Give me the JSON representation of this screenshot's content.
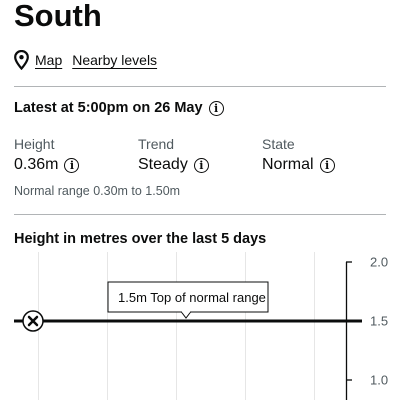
{
  "station": {
    "title": "South"
  },
  "links": {
    "map": "Map",
    "nearby": "Nearby levels"
  },
  "latest": {
    "heading": "Latest at 5:00pm on 26 May"
  },
  "stats": [
    {
      "label": "Height",
      "value": "0.36m"
    },
    {
      "label": "Trend",
      "value": "Steady"
    },
    {
      "label": "State",
      "value": "Normal"
    }
  ],
  "normal_range": "Normal range 0.30m to 1.50m",
  "chart_title": "Height in metres over the last 5 days",
  "tooltip": "1.5m Top of normal range",
  "icons": {
    "pin": "map-pin-icon",
    "info": "info-icon",
    "marker": "close-x-icon"
  },
  "colors": {
    "text": "#0b0c0c",
    "secondary": "#505a5f",
    "rule": "#b1b4b6"
  },
  "chart_data": {
    "type": "line",
    "title": "Height in metres over the last 5 days",
    "y_tick_labels": [
      "2.0",
      "1.5",
      "1.0"
    ],
    "ylim": [
      0.9,
      2.0
    ],
    "reference_lines": [
      {
        "value": 1.5,
        "label": "1.5m Top of normal range"
      }
    ],
    "grid": true
  }
}
